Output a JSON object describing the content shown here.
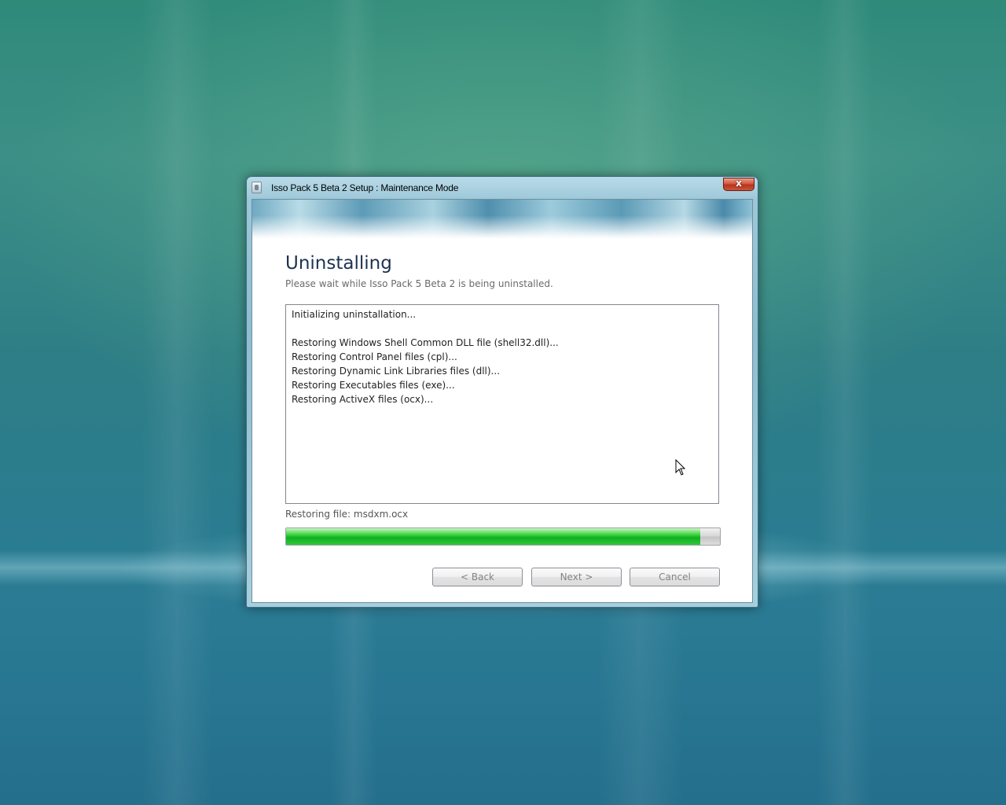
{
  "window": {
    "title": "Isso Pack 5 Beta 2 Setup : Maintenance Mode",
    "close_label": "x",
    "app_icon": "setup-icon"
  },
  "page": {
    "heading": "Uninstalling",
    "subheading": "Please wait while Isso Pack 5 Beta 2 is being uninstalled."
  },
  "log": {
    "lines": [
      "Initializing uninstallation...",
      "",
      "Restoring Windows Shell Common DLL file (shell32.dll)...",
      "Restoring Control Panel files (cpl)...",
      "Restoring Dynamic Link Libraries files (dll)...",
      "Restoring Executables files (exe)...",
      "Restoring ActiveX files (ocx)..."
    ]
  },
  "status": {
    "text": "Restoring file: msdxm.ocx"
  },
  "progress": {
    "fraction": 0.955
  },
  "buttons": {
    "back": "< Back",
    "next": "Next >",
    "cancel": "Cancel"
  },
  "colors": {
    "progress_fill": "#1fbf2a",
    "heading": "#1e3350"
  }
}
